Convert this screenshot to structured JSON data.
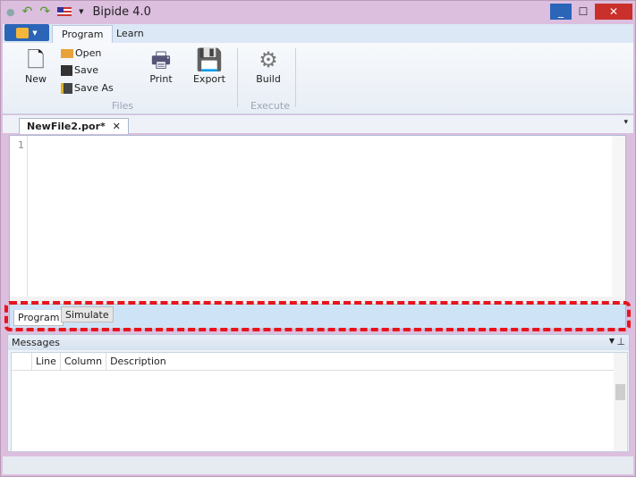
{
  "window": {
    "title": "Bipide 4.0",
    "minimize": "_",
    "maximize": "☐",
    "close": "✕",
    "accent": "#2a65b8",
    "close_color": "#c9302c"
  },
  "ribbon": {
    "tabs": [
      {
        "label": "Program"
      },
      {
        "label": "Learn"
      }
    ],
    "new": "New",
    "open": "Open",
    "save": "Save",
    "save_as": "Save As",
    "print": "Print",
    "export": "Export",
    "build": "Build",
    "groups": {
      "files": "Files",
      "execute": "Execute"
    }
  },
  "document": {
    "tab": "NewFile2.por*",
    "line": "1"
  },
  "editor_tabs": [
    {
      "label": "Program"
    },
    {
      "label": "Simulate"
    }
  ],
  "messages": {
    "title": "Messages",
    "columns": [
      "Line",
      "Column",
      "Description"
    ]
  }
}
